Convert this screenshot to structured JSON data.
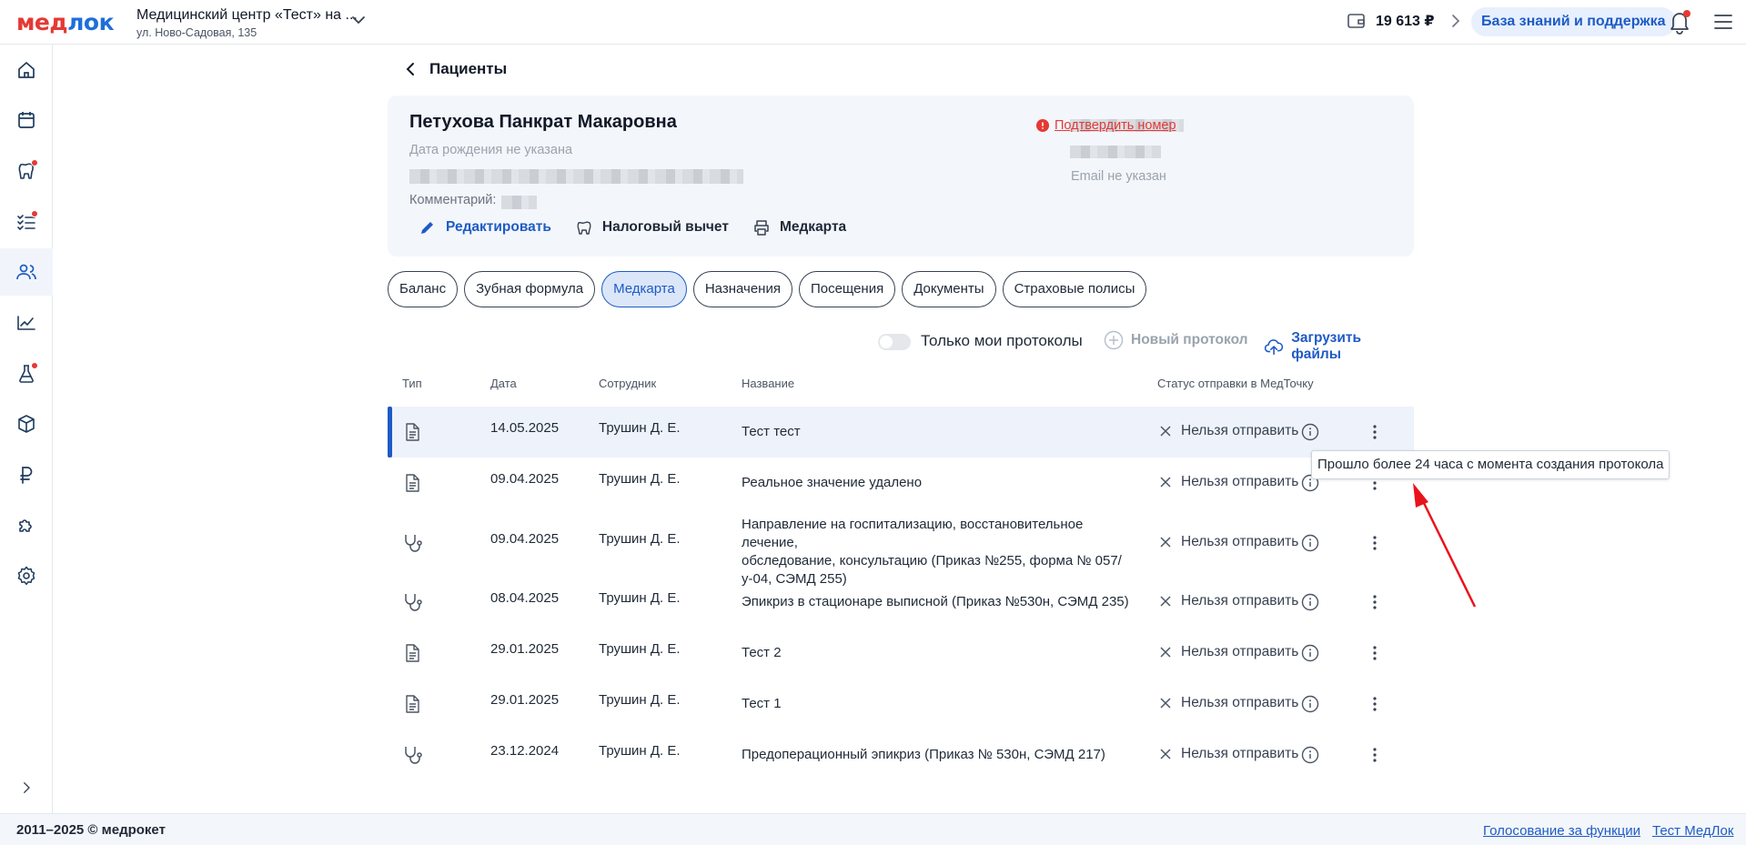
{
  "header": {
    "logo_left": "мед",
    "logo_right": "лок",
    "clinic_name": "Медицинский центр «Тест» на ...",
    "clinic_address": "ул. Ново-Садовая, 135",
    "balance": "19 613 ₽",
    "kb_button": "База знаний и поддержка"
  },
  "sidebar": {
    "items": [
      {
        "icon": "home-icon",
        "dot": false,
        "active": false
      },
      {
        "icon": "calendar-icon",
        "dot": false,
        "active": false
      },
      {
        "icon": "tooth-icon",
        "dot": true,
        "active": false
      },
      {
        "icon": "checklist-icon",
        "dot": true,
        "active": false
      },
      {
        "icon": "users-icon",
        "dot": false,
        "active": true
      },
      {
        "icon": "chart-icon",
        "dot": false,
        "active": false
      },
      {
        "icon": "flask-icon",
        "dot": true,
        "active": false
      },
      {
        "icon": "box-icon",
        "dot": false,
        "active": false
      },
      {
        "icon": "ruble-icon",
        "dot": false,
        "active": false
      },
      {
        "icon": "puzzle-icon",
        "dot": false,
        "active": false
      },
      {
        "icon": "gear-icon",
        "dot": false,
        "active": false
      }
    ]
  },
  "page": {
    "back_title": "Пациенты"
  },
  "patient": {
    "name": "Петухова Панкрат Макаровна",
    "dob": "Дата рождения не указана",
    "comment_label": "Комментарий:",
    "confirm_phone": "Подтвердить номер",
    "email": "Email не указан",
    "actions": {
      "edit": "Редактировать",
      "tax": "Налоговый вычет",
      "medcard": "Медкарта"
    }
  },
  "tabs": [
    "Баланс",
    "Зубная формула",
    "Медкарта",
    "Назначения",
    "Посещения",
    "Документы",
    "Страховые полисы"
  ],
  "active_tab": "Медкарта",
  "toolbar": {
    "toggle_label": "Только мои протоколы",
    "new_protocol": "Новый протокол",
    "upload": "Загрузить файлы"
  },
  "table": {
    "headers": {
      "type": "Тип",
      "date": "Дата",
      "employee": "Сотрудник",
      "name": "Название",
      "status": "Статус отправки в МедТочку"
    },
    "rows": [
      {
        "type": "document-icon",
        "date": "14.05.2025",
        "employee": "Трушин Д. Е.",
        "name": [
          "Тест тест"
        ],
        "status": "Нельзя отправить",
        "selected": true
      },
      {
        "type": "document-icon",
        "date": "09.04.2025",
        "employee": "Трушин Д. Е.",
        "name": [
          "Реальное значение удалено"
        ],
        "status": "Нельзя отправить",
        "selected": false
      },
      {
        "type": "stethoscope-icon",
        "date": "09.04.2025",
        "employee": "Трушин Д. Е.",
        "name": [
          "Направление на госпитализацию, восстановительное лечение,",
          "обследование, консультацию (Приказ №255, форма № 057/",
          "у-04, СЭМД 255)"
        ],
        "status": "Нельзя отправить",
        "selected": false
      },
      {
        "type": "stethoscope-icon",
        "date": "08.04.2025",
        "employee": "Трушин Д. Е.",
        "name": [
          "Эпикриз в стационаре выписной (Приказ №530н, СЭМД 235)"
        ],
        "status": "Нельзя отправить",
        "selected": false
      },
      {
        "type": "document-icon",
        "date": "29.01.2025",
        "employee": "Трушин Д. Е.",
        "name": [
          "Тест 2"
        ],
        "status": "Нельзя отправить",
        "selected": false
      },
      {
        "type": "document-icon",
        "date": "29.01.2025",
        "employee": "Трушин Д. Е.",
        "name": [
          "Тест 1"
        ],
        "status": "Нельзя отправить",
        "selected": false
      },
      {
        "type": "stethoscope-icon",
        "date": "23.12.2024",
        "employee": "Трушин Д. Е.",
        "name": [
          "Предоперационный эпикриз (Приказ № 530н, СЭМД 217)"
        ],
        "status": "Нельзя отправить",
        "selected": false
      }
    ]
  },
  "tooltip": "Прошло более 24 часа с момента создания протокола",
  "footer": {
    "copyright": "2011–2025 © медрокет",
    "vote": "Голосование за функции",
    "test": "Тест МедЛок"
  },
  "colors": {
    "brand_red": "#e53935",
    "brand_blue": "#1e5bc6",
    "annotation_arrow": "#e8141b"
  }
}
